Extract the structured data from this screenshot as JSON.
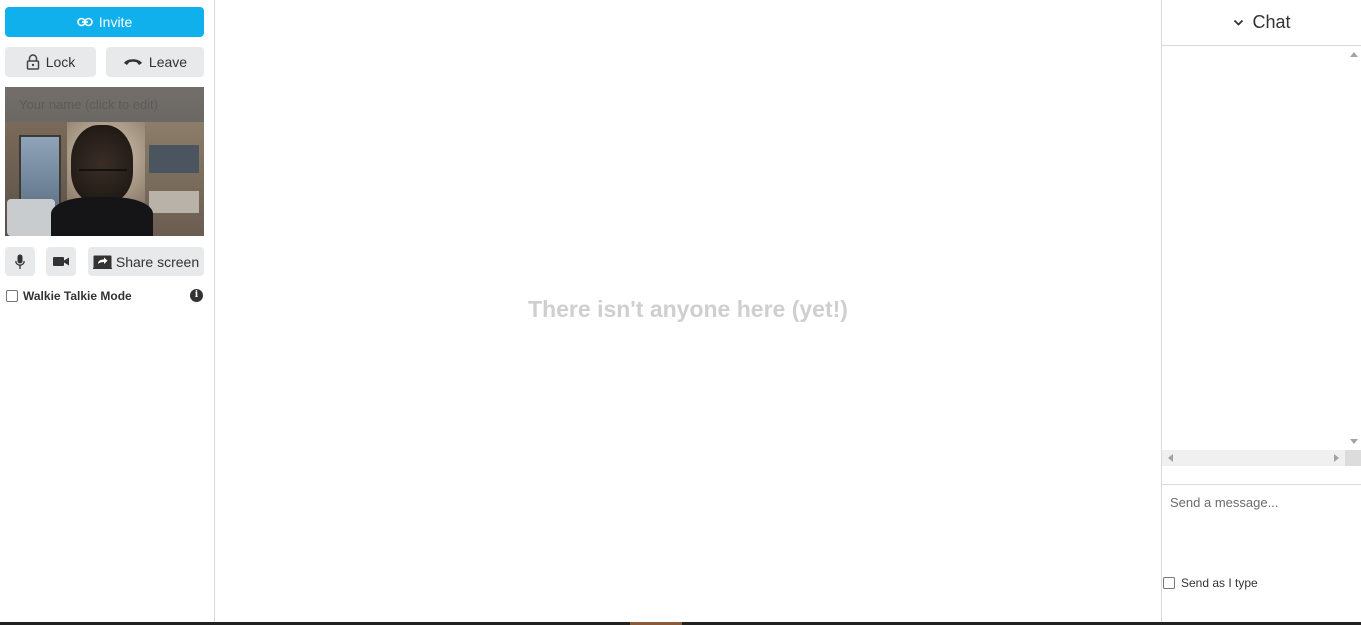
{
  "sidebar": {
    "invite_label": "Invite",
    "lock_label": "Lock",
    "leave_label": "Leave",
    "video_name_placeholder": "Your name (click to edit)",
    "share_screen_label": "Share screen",
    "walkie_talkie_label": "Walkie Talkie Mode",
    "walkie_talkie_checked": false
  },
  "main": {
    "empty_message": "There isn't anyone here (yet!)"
  },
  "chat": {
    "title": "Chat",
    "message_placeholder": "Send a message...",
    "send_as_i_type_label": "Send as I type",
    "send_as_i_type_checked": false
  },
  "colors": {
    "accent": "#0fb0ec",
    "button_gray": "#e7e9eb",
    "empty_text": "#cfcfcf"
  },
  "icons": {
    "invite": "link-icon",
    "lock": "lock-icon",
    "leave": "phone-hangup-icon",
    "mic": "microphone-icon",
    "camera": "video-camera-icon",
    "share": "share-screen-icon",
    "info": "info-icon",
    "chat_toggle": "chevron-down-icon"
  }
}
